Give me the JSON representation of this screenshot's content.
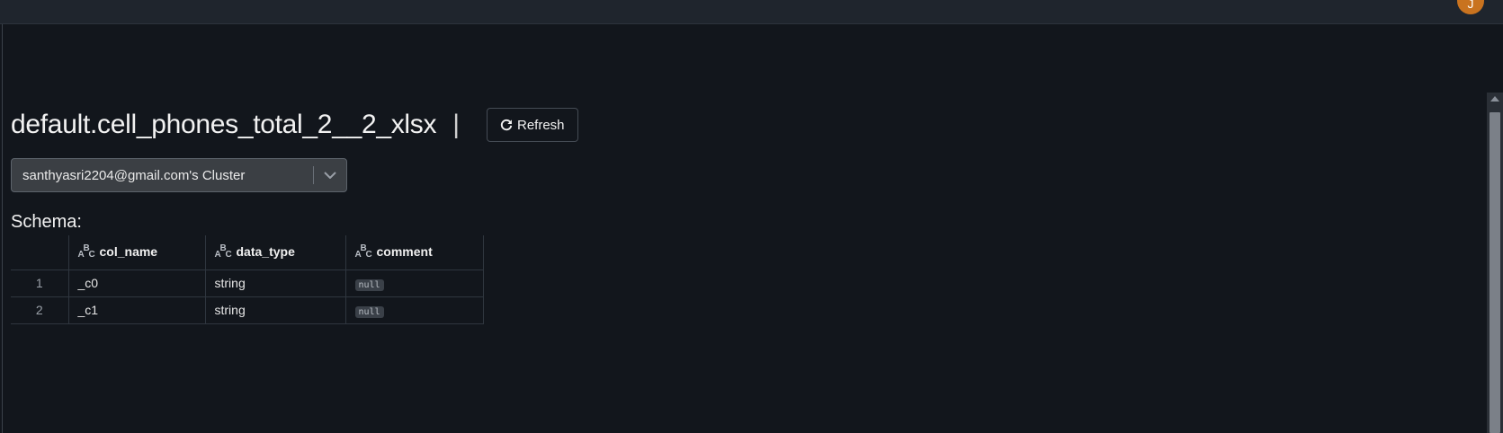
{
  "header": {
    "avatar_initial": "J",
    "avatar_color": "#c9731f"
  },
  "page": {
    "title": "default.cell_phones_total_2__2_xlsx",
    "separator": "|",
    "refresh_label": "Refresh",
    "refresh_icon": "refresh-icon"
  },
  "cluster": {
    "selected": "santhyasri2204@gmail.com's Cluster",
    "dropdown_icon": "chevron-down-icon"
  },
  "schema": {
    "label": "Schema:",
    "type_icon": "string-type-icon",
    "columns": [
      "col_name",
      "data_type",
      "comment"
    ],
    "rows": [
      {
        "index": "1",
        "col_name": "_c0",
        "data_type": "string",
        "comment": "null"
      },
      {
        "index": "2",
        "col_name": "_c1",
        "data_type": "string",
        "comment": "null"
      }
    ]
  }
}
